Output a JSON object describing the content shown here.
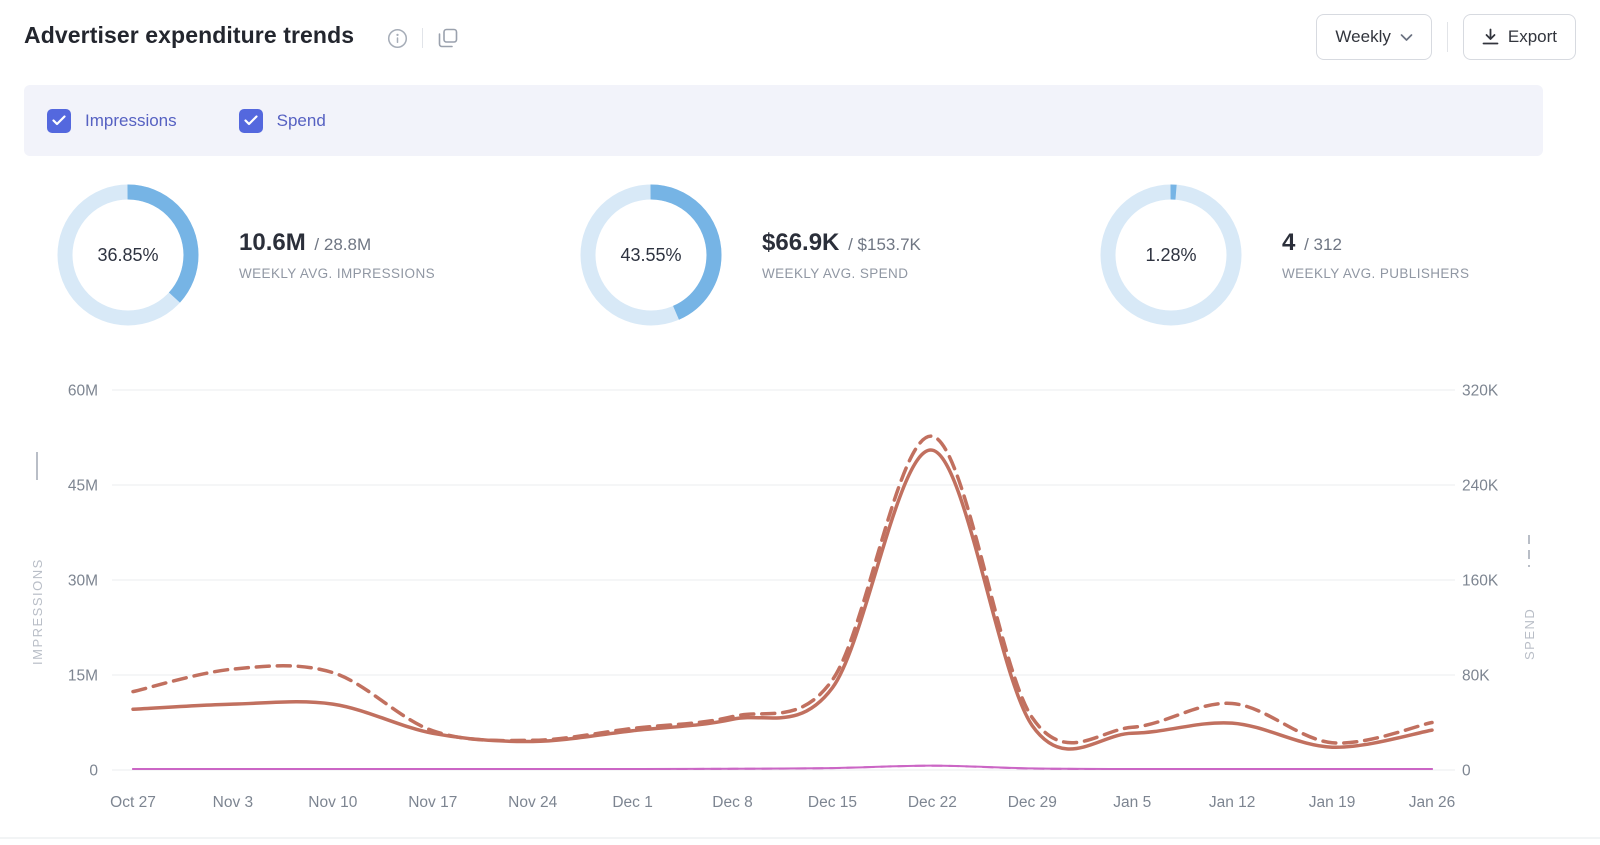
{
  "header": {
    "title": "Advertiser expenditure trends",
    "period_selector": {
      "value": "Weekly"
    },
    "export_label": "Export"
  },
  "filters": {
    "checkboxes": [
      {
        "label": "Impressions",
        "checked": true
      },
      {
        "label": "Spend",
        "checked": true
      }
    ]
  },
  "colors": {
    "accent_blue": "#5468de",
    "donut_fill": "#76b4e5",
    "donut_track": "#d8e9f7",
    "primary_line": "#c1705f",
    "secondary_line": "#cb66c5"
  },
  "stats": [
    {
      "percent": "36.85%",
      "percent_value": 36.85,
      "value": "10.6M",
      "total": "/ 28.8M",
      "label": "WEEKLY AVG. IMPRESSIONS"
    },
    {
      "percent": "43.55%",
      "percent_value": 43.55,
      "value": "$66.9K",
      "total": "/ $153.7K",
      "label": "WEEKLY AVG. SPEND"
    },
    {
      "percent": "1.28%",
      "percent_value": 1.28,
      "value": "4",
      "total": "/ 312",
      "label": "WEEKLY AVG. PUBLISHERS"
    }
  ],
  "chart_data": {
    "type": "line",
    "x": [
      "Oct 27",
      "Nov 3",
      "Nov 10",
      "Nov 17",
      "Nov 24",
      "Dec 1",
      "Dec 8",
      "Dec 15",
      "Dec 22",
      "Dec 29",
      "Jan 5",
      "Jan 12",
      "Jan 19",
      "Jan 26"
    ],
    "left_axis": {
      "title": "IMPRESSIONS",
      "line_style": "solid",
      "tick_values": [
        0,
        15,
        30,
        45,
        60
      ],
      "tick_labels": [
        "0",
        "15M",
        "30M",
        "45M",
        "60M"
      ],
      "unit": "millions"
    },
    "right_axis": {
      "title": "SPEND",
      "line_style": "dashed",
      "tick_values": [
        0,
        80,
        160,
        240,
        320
      ],
      "tick_labels": [
        "0",
        "80K",
        "160K",
        "240K",
        "320K"
      ],
      "unit": "thousands"
    },
    "grid": true,
    "series": [
      {
        "name": "secondary-spend",
        "axis": "right",
        "style": "dashed",
        "secondary": true,
        "color": "#cb66c5",
        "values": [
          0.8,
          0.8,
          0.8,
          0.8,
          0.8,
          0.8,
          1.0,
          1.6,
          3.6,
          1.2,
          0.8,
          0.8,
          0.8,
          0.8
        ]
      },
      {
        "name": "secondary-impressions",
        "axis": "left",
        "style": "solid",
        "secondary": true,
        "color": "#cb66c5",
        "values": [
          0.15,
          0.15,
          0.15,
          0.15,
          0.15,
          0.15,
          0.2,
          0.3,
          0.7,
          0.25,
          0.15,
          0.15,
          0.15,
          0.15
        ]
      },
      {
        "name": "spend",
        "axis": "right",
        "style": "dashed",
        "secondary": false,
        "color": "#c1705f",
        "values": [
          66,
          85,
          82,
          33,
          25,
          35,
          45,
          76,
          281,
          44,
          36,
          56,
          23,
          40
        ]
      },
      {
        "name": "impressions",
        "axis": "left",
        "style": "solid",
        "secondary": false,
        "color": "#c1705f",
        "values": [
          9.6,
          10.4,
          10.4,
          5.8,
          4.5,
          6.2,
          8.0,
          13.0,
          50.5,
          7.0,
          5.8,
          7.4,
          3.6,
          6.3
        ]
      }
    ]
  }
}
